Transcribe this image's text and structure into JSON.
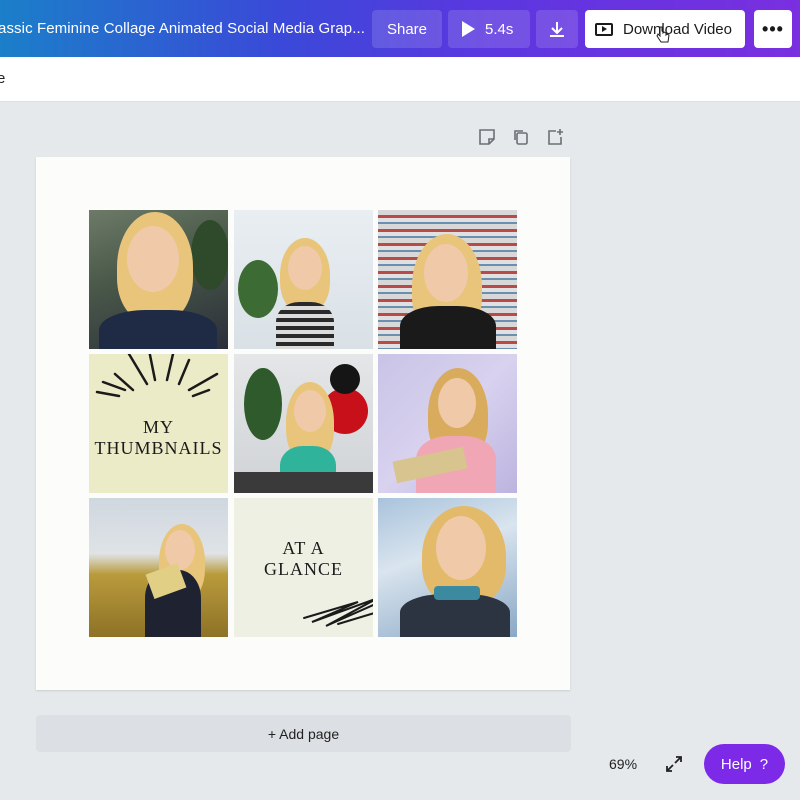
{
  "header": {
    "title": "assic Feminine Collage Animated Social Media Grap...",
    "share_label": "Share",
    "play_duration": "5.4s",
    "download_video_label": "Download Video",
    "more_label": "•••",
    "gradient_start": "#1b7fc9",
    "gradient_end": "#7a2fe0"
  },
  "subbar": {
    "partial_text": "e"
  },
  "page_tools": [
    "note-icon",
    "duplicate-icon",
    "add-page-icon"
  ],
  "collage": {
    "tiles": [
      {
        "type": "photo"
      },
      {
        "type": "photo"
      },
      {
        "type": "photo"
      },
      {
        "type": "label",
        "lines": [
          "MY",
          "THUMBNAILS"
        ],
        "bg": "#ecebc8"
      },
      {
        "type": "photo"
      },
      {
        "type": "photo"
      },
      {
        "type": "photo"
      },
      {
        "type": "label",
        "lines": [
          "AT A",
          "GLANCE"
        ],
        "bg": "#eef0e4"
      },
      {
        "type": "photo"
      }
    ],
    "label1_line1": "MY",
    "label1_line2": "THUMBNAILS",
    "label2_line1": "AT A",
    "label2_line2": "GLANCE"
  },
  "add_page_label": "+ Add page",
  "footer": {
    "zoom": "69%",
    "help_label": "Help",
    "help_icon": "?",
    "help_color": "#7d2ae8"
  }
}
